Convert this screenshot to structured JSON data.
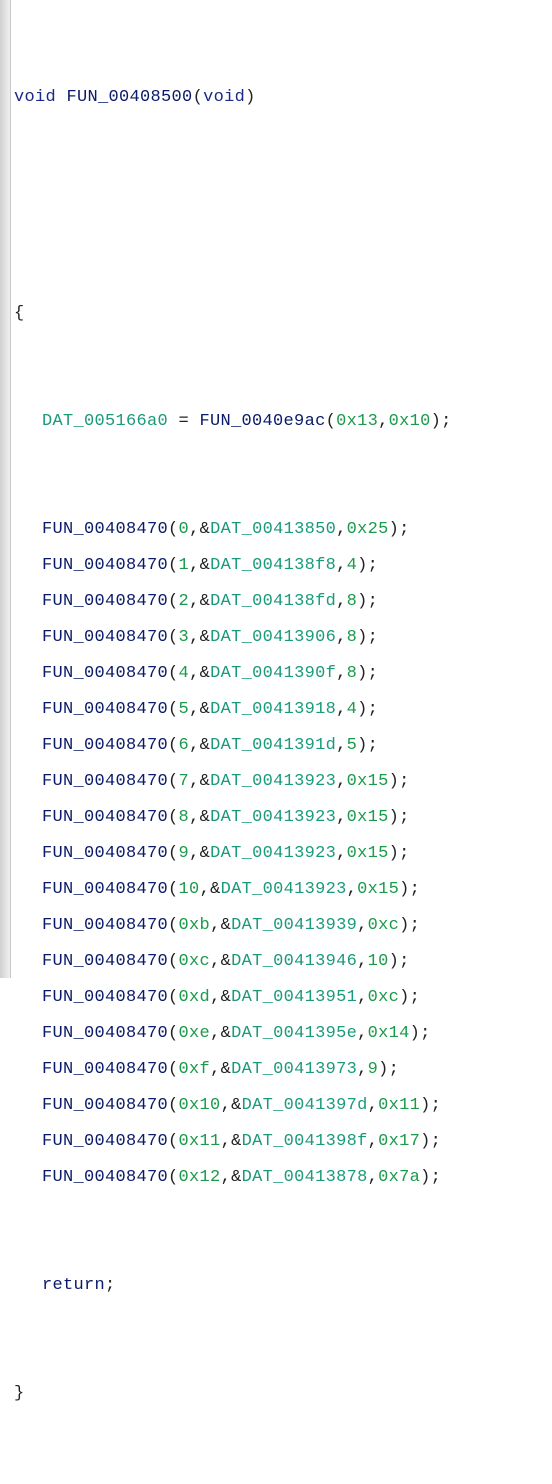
{
  "signature": {
    "ret_type": "void",
    "name": "FUN_00408500",
    "args": "void"
  },
  "assign": {
    "lhs": "DAT_005166a0",
    "eq": " = ",
    "fn": "FUN_0040e9ac",
    "a1": "0x13",
    "a2": "0x10"
  },
  "calls": [
    {
      "fn": "FUN_00408470",
      "a1": "0",
      "addr": "DAT_00413850",
      "a3": "0x25"
    },
    {
      "fn": "FUN_00408470",
      "a1": "1",
      "addr": "DAT_004138f8",
      "a3": "4"
    },
    {
      "fn": "FUN_00408470",
      "a1": "2",
      "addr": "DAT_004138fd",
      "a3": "8"
    },
    {
      "fn": "FUN_00408470",
      "a1": "3",
      "addr": "DAT_00413906",
      "a3": "8"
    },
    {
      "fn": "FUN_00408470",
      "a1": "4",
      "addr": "DAT_0041390f",
      "a3": "8"
    },
    {
      "fn": "FUN_00408470",
      "a1": "5",
      "addr": "DAT_00413918",
      "a3": "4"
    },
    {
      "fn": "FUN_00408470",
      "a1": "6",
      "addr": "DAT_0041391d",
      "a3": "5"
    },
    {
      "fn": "FUN_00408470",
      "a1": "7",
      "addr": "DAT_00413923",
      "a3": "0x15"
    },
    {
      "fn": "FUN_00408470",
      "a1": "8",
      "addr": "DAT_00413923",
      "a3": "0x15"
    },
    {
      "fn": "FUN_00408470",
      "a1": "9",
      "addr": "DAT_00413923",
      "a3": "0x15"
    },
    {
      "fn": "FUN_00408470",
      "a1": "10",
      "addr": "DAT_00413923",
      "a3": "0x15"
    },
    {
      "fn": "FUN_00408470",
      "a1": "0xb",
      "addr": "DAT_00413939",
      "a3": "0xc"
    },
    {
      "fn": "FUN_00408470",
      "a1": "0xc",
      "addr": "DAT_00413946",
      "a3": "10"
    },
    {
      "fn": "FUN_00408470",
      "a1": "0xd",
      "addr": "DAT_00413951",
      "a3": "0xc"
    },
    {
      "fn": "FUN_00408470",
      "a1": "0xe",
      "addr": "DAT_0041395e",
      "a3": "0x14"
    },
    {
      "fn": "FUN_00408470",
      "a1": "0xf",
      "addr": "DAT_00413973",
      "a3": "9"
    },
    {
      "fn": "FUN_00408470",
      "a1": "0x10",
      "addr": "DAT_0041397d",
      "a3": "0x11"
    },
    {
      "fn": "FUN_00408470",
      "a1": "0x11",
      "addr": "DAT_0041398f",
      "a3": "0x17"
    },
    {
      "fn": "FUN_00408470",
      "a1": "0x12",
      "addr": "DAT_00413878",
      "a3": "0x7a"
    }
  ],
  "ret_stmt": "return",
  "punct": {
    "open_paren": "(",
    "close_paren": ")",
    "open_brace": "{",
    "close_brace": "}",
    "comma": ",",
    "amp": "&",
    "semi": ";"
  }
}
